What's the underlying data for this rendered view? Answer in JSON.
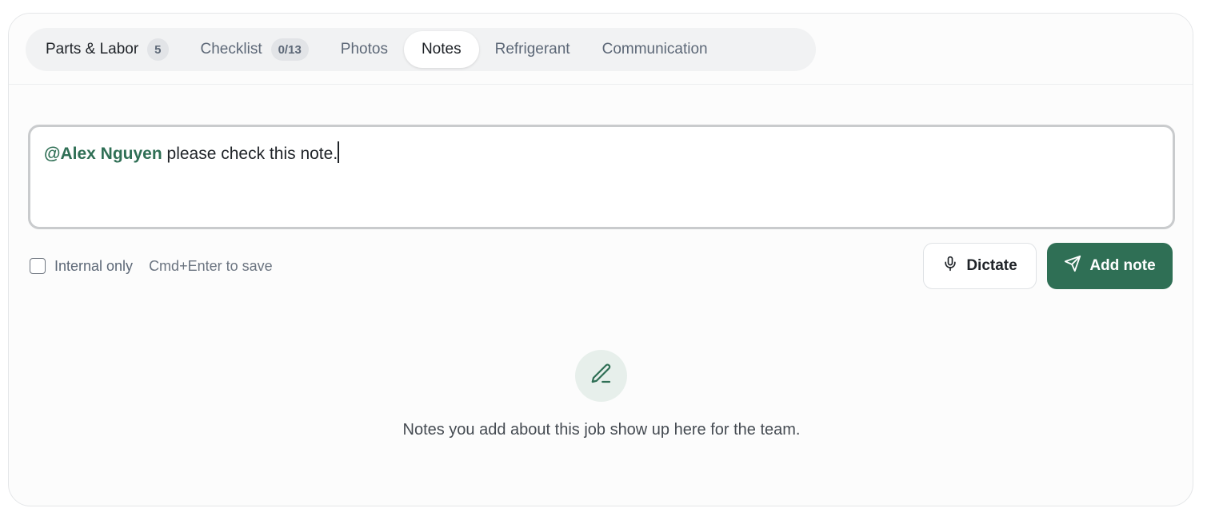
{
  "tabs": [
    {
      "label": "Parts & Labor",
      "badge": "5"
    },
    {
      "label": "Checklist",
      "badge": "0/13"
    },
    {
      "label": "Photos"
    },
    {
      "label": "Notes",
      "active": true
    },
    {
      "label": "Refrigerant"
    },
    {
      "label": "Communication"
    }
  ],
  "editor": {
    "mention": "@Alex Nguyen",
    "text": " please check this note."
  },
  "options": {
    "internal_label": "Internal only",
    "internal_checked": false,
    "shortcut_hint": "Cmd+Enter to save"
  },
  "actions": {
    "dictate_label": "Dictate",
    "dictate_icon": "microphone-icon",
    "add_label": "Add note",
    "add_icon": "send-icon"
  },
  "empty_state": {
    "icon": "pencil-icon",
    "message": "Notes you add about this job show up here for the team."
  },
  "colors": {
    "accent": "#2f6f55",
    "accent_soft": "#e7efeb"
  }
}
